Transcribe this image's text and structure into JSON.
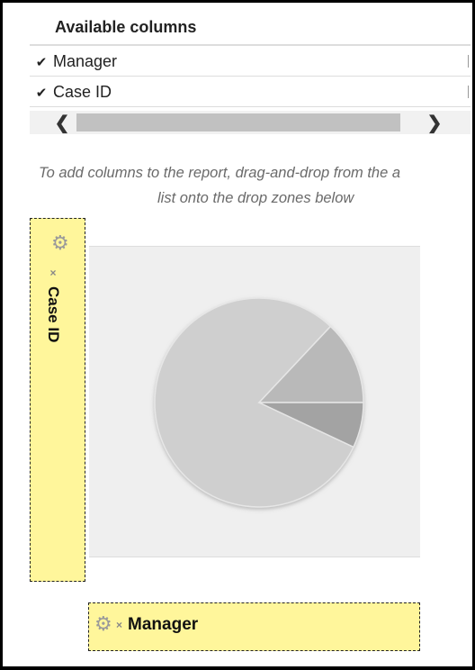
{
  "columns_panel": {
    "title": "Available columns",
    "items": [
      {
        "label": "Manager",
        "checked": true,
        "check_glyph": "✔"
      },
      {
        "label": "Case ID",
        "checked": true,
        "check_glyph": "✔"
      }
    ],
    "scroll_left_glyph": "❮",
    "scroll_right_glyph": "❯"
  },
  "hint": {
    "line1": "To add columns to the report, drag-and-drop from the a",
    "line2": "list onto the drop zones below"
  },
  "row_drop_zone": {
    "gear_glyph": "⚙",
    "remove_glyph": "×",
    "field_label": "Case ID"
  },
  "column_drop_zone": {
    "gear_glyph": "⚙",
    "remove_glyph": "×",
    "field_label": "Manager"
  },
  "chart_data": {
    "type": "pie",
    "title": "",
    "values": [
      80,
      13,
      7
    ],
    "colors": [
      "#cfcfcf",
      "#b9b9b9",
      "#a3a3a3"
    ]
  }
}
